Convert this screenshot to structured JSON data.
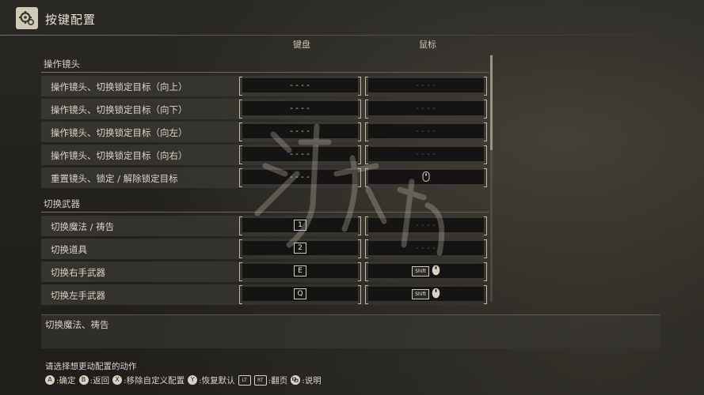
{
  "header": {
    "title": "按键配置",
    "icon": "gear-icon"
  },
  "columns": {
    "keyboard": "键盘",
    "mouse": "鼠标"
  },
  "sections": [
    {
      "label": "操作镜头",
      "rows": [
        {
          "label": "操作镜头、切换锁定目标（向上）",
          "keyboard": "----",
          "mouse": "----"
        },
        {
          "label": "操作镜头、切换锁定目标（向下）",
          "keyboard": "----",
          "mouse": "----"
        },
        {
          "label": "操作镜头、切换锁定目标（向左）",
          "keyboard": "----",
          "mouse": "----"
        },
        {
          "label": "操作镜头、切换锁定目标（向右）",
          "keyboard": "----",
          "mouse": "----"
        },
        {
          "label": "重置镜头、锁定 / 解除锁定目标",
          "keyboard": "----",
          "mouse": "mouse-middle-icon"
        }
      ]
    },
    {
      "label": "切换武器",
      "rows": [
        {
          "label": "切换魔法 / 祷告",
          "keyboard": "1",
          "mouse": "----"
        },
        {
          "label": "切换道具",
          "keyboard": "2",
          "mouse": "----"
        },
        {
          "label": "切换右手武器",
          "keyboard": "E",
          "mouse_key": "Shift",
          "mouse": "mouse-wheel-icon"
        },
        {
          "label": "切换左手武器",
          "keyboard": "Q",
          "mouse_key": "Shift",
          "mouse": "mouse-wheel-icon"
        }
      ]
    }
  ],
  "description": "切换魔法、祷告",
  "hint": "请选择想更动配置的动作",
  "controls": [
    {
      "button": "A",
      "label": ":确定"
    },
    {
      "button": "B",
      "label": ":返回"
    },
    {
      "button": "X",
      "label": ":移除自定义配置"
    },
    {
      "button": "Y",
      "label": ":恢复默认"
    },
    {
      "button": "LT",
      "label": ""
    },
    {
      "button": "RT",
      "label": ":翻页"
    },
    {
      "button": "VIEW",
      "label": ":说明"
    }
  ]
}
